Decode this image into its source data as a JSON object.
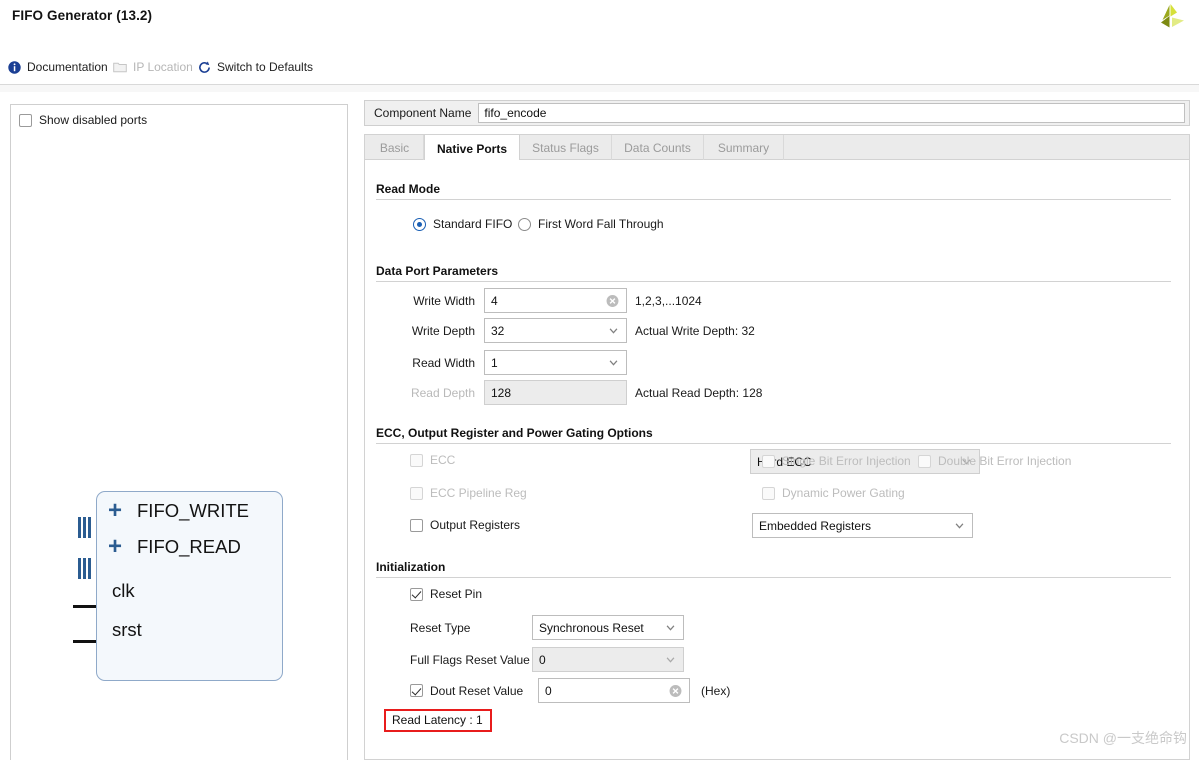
{
  "window": {
    "title": "FIFO Generator (13.2)",
    "logo_icon": "xilinx-logo-icon"
  },
  "toolbar": {
    "items": [
      {
        "label": "Documentation",
        "icon": "info-icon",
        "enabled": true
      },
      {
        "label": "IP Location",
        "icon": "folder-icon",
        "enabled": false
      },
      {
        "label": "Switch to Defaults",
        "icon": "refresh-icon",
        "enabled": true
      }
    ]
  },
  "left_panel": {
    "show_disabled_ports": {
      "label": "Show disabled ports",
      "checked": false
    },
    "diagram": {
      "buses": [
        {
          "label": "FIFO_WRITE",
          "expander": "+"
        },
        {
          "label": "FIFO_READ",
          "expander": "+"
        }
      ],
      "pins": [
        {
          "label": "clk"
        },
        {
          "label": "srst"
        }
      ]
    }
  },
  "component": {
    "name_label": "Component Name",
    "name_value": "fifo_encode"
  },
  "tabs": [
    {
      "label": "Basic",
      "active": false
    },
    {
      "label": "Native Ports",
      "active": true
    },
    {
      "label": "Status Flags",
      "active": false
    },
    {
      "label": "Data Counts",
      "active": false
    },
    {
      "label": "Summary",
      "active": false
    }
  ],
  "read_mode": {
    "section_title": "Read Mode",
    "options": [
      {
        "label": "Standard FIFO",
        "selected": true
      },
      {
        "label": "First Word Fall Through",
        "selected": false
      }
    ]
  },
  "data_port_parameters": {
    "section_title": "Data Port Parameters",
    "write_width": {
      "label": "Write Width",
      "value": "4",
      "hint": "1,2,3,...1024",
      "clear_icon": "clear-icon"
    },
    "write_depth": {
      "label": "Write Depth",
      "value": "32",
      "hint": "Actual Write Depth: 32"
    },
    "read_width": {
      "label": "Read Width",
      "value": "1",
      "hint": ""
    },
    "read_depth": {
      "label": "Read Depth",
      "value": "128",
      "hint": "Actual Read Depth: 128",
      "disabled": true
    }
  },
  "ecc_options": {
    "section_title": "ECC, Output Register and Power Gating Options",
    "ecc": {
      "label": "ECC",
      "checked": false,
      "disabled": true
    },
    "ecc_mode": {
      "value": "Hard ECC",
      "disabled": true
    },
    "single_bit_error_injection": {
      "label": "Single Bit Error Injection",
      "checked": false,
      "disabled": true
    },
    "double_bit_error_injection": {
      "label": "Double Bit Error Injection",
      "checked": false,
      "disabled": true
    },
    "ecc_pipeline_reg": {
      "label": "ECC Pipeline Reg",
      "checked": false,
      "disabled": true
    },
    "dynamic_power_gating": {
      "label": "Dynamic Power Gating",
      "checked": false,
      "disabled": true
    },
    "output_registers": {
      "label": "Output Registers",
      "checked": false,
      "disabled": false
    },
    "output_register_type": {
      "value": "Embedded Registers",
      "disabled": false
    }
  },
  "initialization": {
    "section_title": "Initialization",
    "reset_pin": {
      "label": "Reset Pin",
      "checked": true
    },
    "reset_type": {
      "label": "Reset Type",
      "value": "Synchronous Reset"
    },
    "full_flags_reset_value": {
      "label": "Full Flags Reset Value",
      "value": "0",
      "disabled": true
    },
    "dout_reset_value": {
      "label": "Dout Reset Value",
      "checked": true,
      "value": "0",
      "suffix": "(Hex)",
      "clear_icon": "clear-icon"
    },
    "read_latency": "Read Latency : 1"
  },
  "watermark": "CSDN @一支绝命钩",
  "colors": {
    "accent_blue": "#1a5fb4",
    "highlight_red": "#e81c1c",
    "diagram_border": "#8fa9c9",
    "panel_border": "#cfcfcf"
  }
}
